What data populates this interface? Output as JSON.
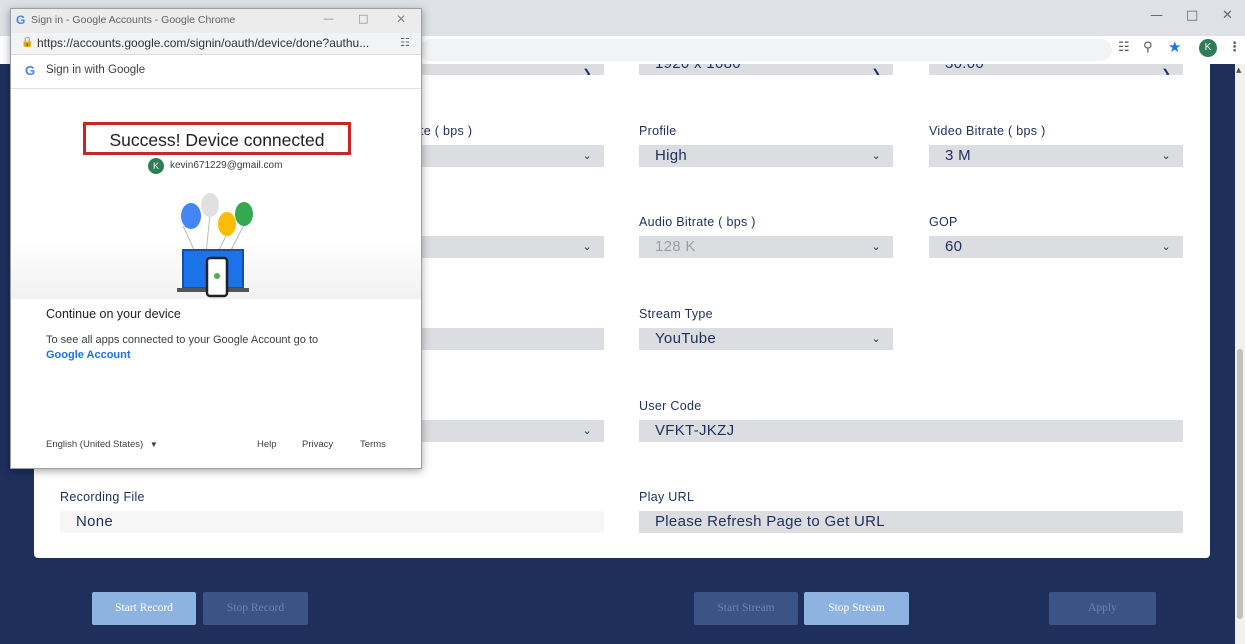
{
  "browser": {
    "min_icon": "minimize-icon",
    "max_icon": "maximize-icon",
    "close_icon": "close-icon",
    "avatar_initial": "K"
  },
  "popup": {
    "window_title": "Sign in - Google Accounts - Google Chrome",
    "url": "https://accounts.google.com/signin/oauth/device/done?authu...",
    "header": "Sign in with Google",
    "success": "Success! Device connected",
    "account_initial": "K",
    "account_email": "kevin671229@gmail.com",
    "continue_heading": "Continue on your device",
    "description": "To see all apps connected to your Google Account go to",
    "google_account_link": "Google Account",
    "language": "English (United States)",
    "help": "Help",
    "privacy": "Privacy",
    "terms": "Terms"
  },
  "form": {
    "resolution": "1920 x 1080",
    "framerate": "30.00",
    "bitrate_label_partial": "te ( bps )",
    "profile_label": "Profile",
    "profile_value": "High",
    "video_bitrate_label": "Video Bitrate ( bps )",
    "video_bitrate_value": "3 M",
    "audio_bitrate_label": "Audio Bitrate ( bps )",
    "audio_bitrate_value": "128 K",
    "gop_label": "GOP",
    "gop_value": "60",
    "stream_type_label": "Stream Type",
    "stream_type_value": "YouTube",
    "user_code_label": "User Code",
    "user_code_value": "VFKT-JKZJ",
    "recording_file_label": "Recording File",
    "recording_file_value": "None",
    "play_url_label": "Play URL",
    "play_url_value": "Please Refresh Page to Get URL"
  },
  "buttons": {
    "start_record": "Start Record",
    "stop_record": "Stop Record",
    "start_stream": "Start Stream",
    "stop_stream": "Stop Stream",
    "apply": "Apply"
  },
  "colors": {
    "navy": "#1e2f5c",
    "field_bg": "#dcdde0",
    "button_active": "#8fb3e0",
    "button_disabled": "#3a5488",
    "highlight_red": "#c62828"
  }
}
